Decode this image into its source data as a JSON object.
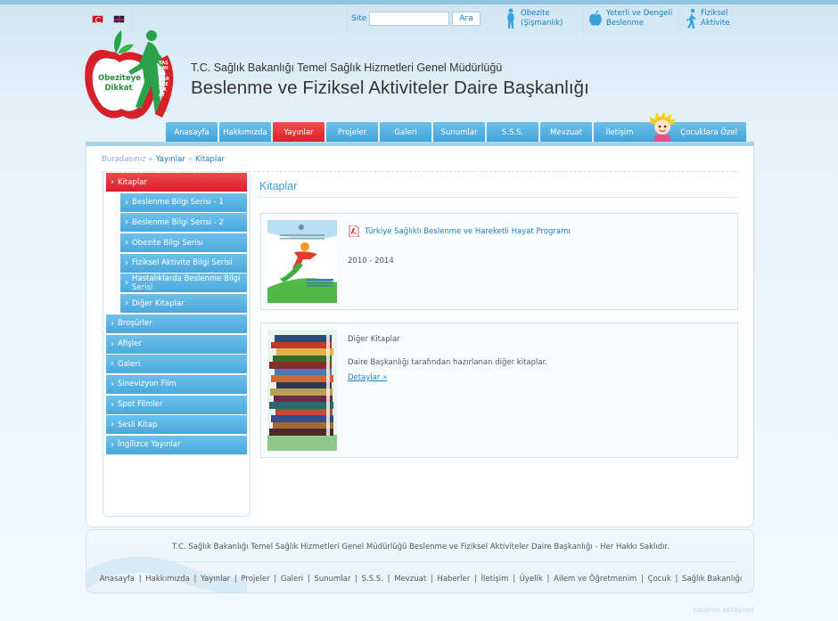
{
  "topbar": {
    "search_label": "Site",
    "search_placeholder": "",
    "search_button": "Ara",
    "quicklinks": [
      {
        "line1": "Obezite",
        "line2": "(Şişmanlık)",
        "icon": "silhouette-icon"
      },
      {
        "line1": "Yeterli ve Dengeli",
        "line2": "Beslenme",
        "icon": "apple-icon"
      },
      {
        "line1": "Fiziksel",
        "line2": "Aktivite",
        "icon": "runner-icon"
      }
    ]
  },
  "header": {
    "ministry": "T.C. Sağlık Bakanlığı Temel Sağlık Hizmetleri Genel Müdürlüğü",
    "department": "Beslenme ve Fiziksel Aktiviteler Daire Başkanlığı",
    "logo_text": [
      "Obeziteye",
      "Dikkat"
    ],
    "logo_arc": "YAŞAMINA HAREKET KAT"
  },
  "nav": {
    "items": [
      "Anasayfa",
      "Hakkımızda",
      "Yayınlar",
      "Projeler",
      "Galeri",
      "Sunumlar",
      "S.S.S.",
      "Mevzuat",
      "İletişim"
    ],
    "kids": "Çocuklara Özel"
  },
  "breadcrumb": {
    "prefix": "Buradasınız",
    "items": [
      "Yayınlar",
      "Kitaplar"
    ]
  },
  "sidebar": {
    "active": "Kitaplar",
    "subitems": [
      "Beslenme Bilgi Serisi - 1",
      "Beslenme Bilgi Serisi - 2",
      "Obezite Bilgi Serisi",
      "Fiziksel Aktivite Bilgi Serisi",
      "Hastalıklarda Beslenme Bilgi Serisi",
      "Diğer Kitaplar"
    ],
    "items": [
      "Broşürler",
      "Afişler",
      "Galeri",
      "Sinevizyon Film",
      "Spot Filmler",
      "Sesli Kitap",
      "İngilizce Yayınlar"
    ]
  },
  "content": {
    "title": "Kitaplar",
    "card1": {
      "link": "Türkiye Sağlıklı Beslenme ve Hareketli Hayat Programı",
      "years": "2010 - 2014"
    },
    "card2": {
      "title": "Diğer Kitaplar",
      "desc": "Daire Başkanlığı tarafından hazırlanan diğer kitaplar.",
      "link": "Detaylar »"
    }
  },
  "footer": {
    "copyright": "T.C. Sağlık Bakanlığı Temel Sağlık Hizmetleri Genel Müdürlüğü Beslenme ve Fiziksel Aktiviteler Daire Başkanlığı - Her Hakkı Saklıdır.",
    "links": [
      "Anasayfa",
      "Hakkımızda",
      "Yayınlar",
      "Projeler",
      "Galeri",
      "Sunumlar",
      "S.S.S.",
      "Mevzuat",
      "Haberler",
      "İletişim",
      "Üyelik",
      "Ailem ve Öğretmenim",
      "Çocuk",
      "Sağlık Bakanlığı"
    ],
    "designer": "tasarım aktaynet"
  },
  "colors": {
    "accent": "#3fa3da",
    "active": "#d81e2a",
    "link": "#1a7dc0"
  }
}
